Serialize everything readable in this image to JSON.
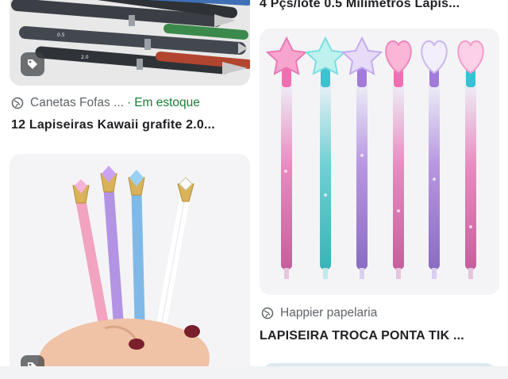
{
  "results": [
    {
      "source": "Canetas Fofas ...",
      "stock_separator": "·",
      "stock": "Em estoque",
      "title": "12 Lapiseiras Kawaii grafite 2.0...",
      "has_tag": true
    },
    {
      "source": "",
      "title": "4 Pçs/lote 0.5 Milímetros Lapis...",
      "has_tag": false
    },
    {
      "source": "Happier papelaria",
      "title": "LAPISEIRA TROCA PONTA TIK ...",
      "has_tag": false
    }
  ],
  "icons": {
    "source": "globe-icon",
    "tag": "price-tag-icon"
  },
  "colors": {
    "stock": "#188038",
    "secondary_text": "#5f6368",
    "primary_text": "#202124"
  }
}
